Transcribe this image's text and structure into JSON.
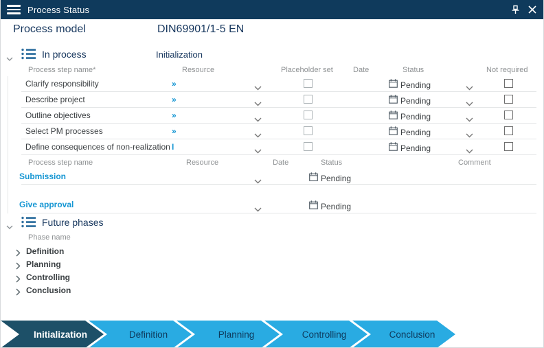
{
  "window": {
    "title": "Process Status"
  },
  "header": {
    "model_label": "Process model",
    "model_value": "DIN69901/1-5 EN"
  },
  "in_process": {
    "title": "In process",
    "phase": "Initialization",
    "columns": {
      "name": "Process step name*",
      "resource": "Resource",
      "placeholder": "Placeholder set",
      "date": "Date",
      "status": "Status",
      "not_required": "Not required"
    },
    "rows": [
      {
        "name": "Clarify responsibility",
        "resource": "»",
        "status": "Pending"
      },
      {
        "name": "Describe project",
        "resource": "»",
        "status": "Pending"
      },
      {
        "name": "Outline objectives",
        "resource": "»",
        "status": "Pending"
      },
      {
        "name": "Select PM processes",
        "resource": "»",
        "status": "Pending"
      },
      {
        "name": "Define consequences of non-realization",
        "resource": "I",
        "status": "Pending"
      }
    ],
    "milestone_columns": {
      "name": "Process step name",
      "resource": "Resource",
      "date": "Date",
      "status": "Status",
      "comment": "Comment"
    },
    "milestones": [
      {
        "name": "Submission",
        "status": "Pending"
      },
      {
        "name": "Give approval",
        "status": "Pending"
      }
    ]
  },
  "future_phases": {
    "title": "Future phases",
    "column": "Phase name",
    "phases": [
      {
        "name": "Definition"
      },
      {
        "name": "Planning"
      },
      {
        "name": "Controlling"
      },
      {
        "name": "Conclusion"
      }
    ]
  },
  "phase_bar": {
    "items": [
      {
        "label": "Initialization",
        "active": true
      },
      {
        "label": "Definition",
        "active": false
      },
      {
        "label": "Planning",
        "active": false
      },
      {
        "label": "Controlling",
        "active": false
      },
      {
        "label": "Conclusion",
        "active": false
      }
    ]
  },
  "colors": {
    "titlebar": "#0F3A5C",
    "heading_navy": "#17375E",
    "link_blue": "#1596D3",
    "phase_active": "#1D5068",
    "phase_inactive": "#29ABE2"
  }
}
